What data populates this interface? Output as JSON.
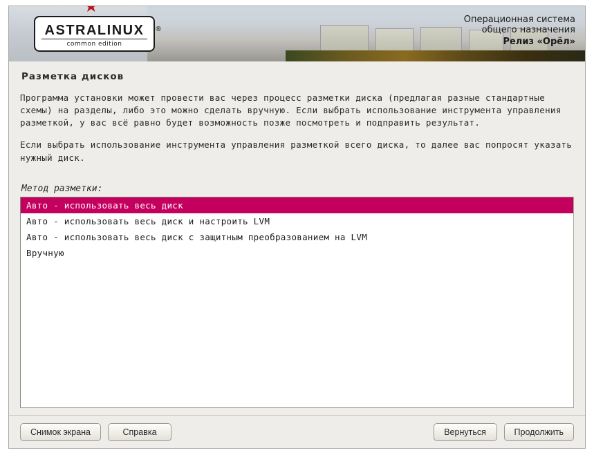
{
  "header": {
    "brand": "ASTRALINUX",
    "edition": "common edition",
    "tagline1": "Операционная система",
    "tagline2": "общего назначения",
    "release": "Релиз «Орёл»"
  },
  "page": {
    "title": "Разметка дисков",
    "para1": "Программа установки может провести вас через процесс разметки диска (предлагая разные стандартные схемы) на разделы, либо это можно сделать вручную. Если выбрать использование инструмента управления разметкой, у вас всё равно будет возможность позже посмотреть и подправить результат.",
    "para2": "Если выбрать использование инструмента управления разметкой всего диска, то далее вас попросят указать нужный диск.",
    "method_label": "Метод разметки:"
  },
  "methods": [
    {
      "label": "Авто - использовать весь диск",
      "selected": true
    },
    {
      "label": "Авто - использовать весь диск и настроить LVM",
      "selected": false
    },
    {
      "label": "Авто - использовать весь диск с защитным преобразованием на LVM",
      "selected": false
    },
    {
      "label": "Вручную",
      "selected": false
    }
  ],
  "buttons": {
    "screenshot": "Снимок экрана",
    "help": "Справка",
    "back": "Вернуться",
    "continue": "Продолжить"
  }
}
